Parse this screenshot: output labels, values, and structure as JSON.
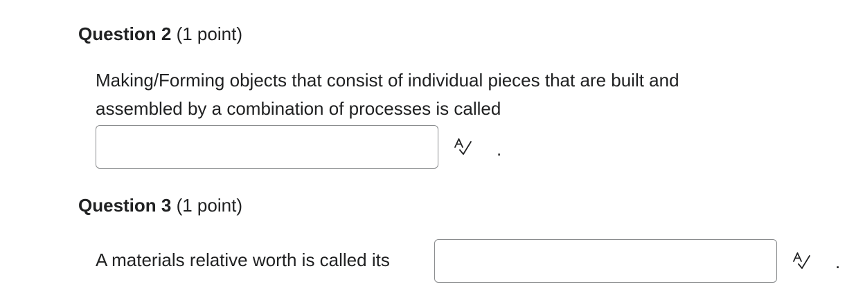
{
  "questions": [
    {
      "title": "Question 2",
      "points": "(1 point)",
      "text_lines": [
        "Making/Forming objects that consist of individual pieces that are built and",
        "assembled by a combination of processes is called"
      ],
      "answer_value": "",
      "trailing": "."
    },
    {
      "title": "Question 3",
      "points": "(1 point)",
      "text": "A materials relative worth is called its",
      "answer_value": "",
      "trailing": "."
    }
  ],
  "icons": {
    "spell_check": "spell-check-icon"
  },
  "colors": {
    "text": "#202122",
    "input_border": "#8a8c8e"
  }
}
